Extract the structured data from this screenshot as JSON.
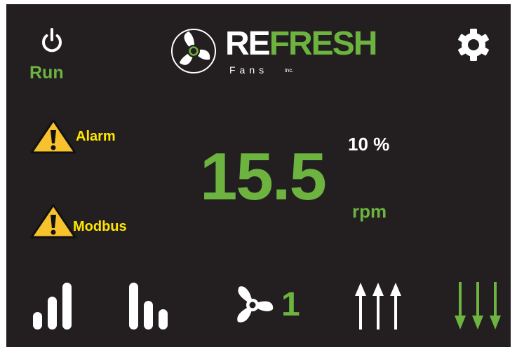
{
  "status": {
    "run_label": "Run"
  },
  "brand": {
    "word_left": "RE",
    "word_right": "FRESH",
    "sub": "Fans",
    "suffix": "inc."
  },
  "alerts": [
    {
      "label": "Alarm"
    },
    {
      "label": "Modbus"
    }
  ],
  "readout": {
    "speed": "15.5",
    "unit": "rpm",
    "percent": "10 %"
  },
  "fan": {
    "number": "1"
  },
  "colors": {
    "background": "#231f20",
    "accent": "#6cb33f",
    "warning": "#ffe600",
    "text": "#ffffff"
  },
  "icons": [
    "power-icon",
    "settings-gear-icon",
    "warning-icon",
    "signal-bars-icon",
    "bars-descending-icon",
    "fan-icon",
    "arrows-up-icon",
    "arrows-down-icon"
  ]
}
